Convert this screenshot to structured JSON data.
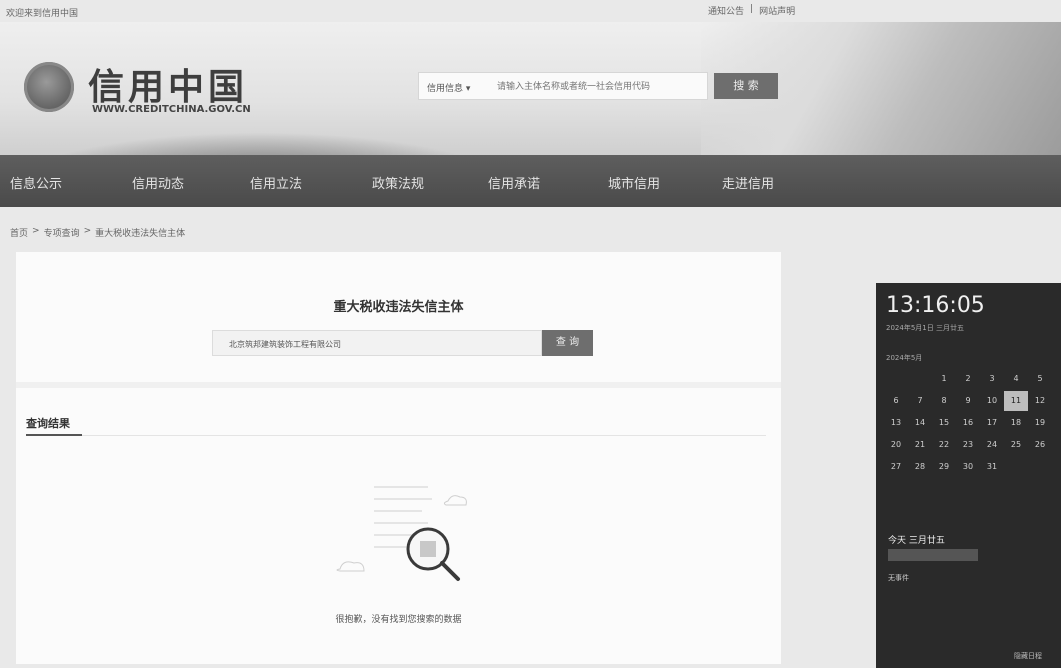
{
  "topbar": {
    "welcome": "欢迎来到信用中国",
    "notice": "通知公告",
    "separator": "|",
    "statement": "网站声明"
  },
  "header": {
    "logo_title": "信用中国",
    "logo_url": "WWW.CREDITCHINA.GOV.CN",
    "search_category": "信用信息 ▾",
    "search_placeholder": "请输入主体名称或者统一社会信用代码",
    "search_button": "搜 索"
  },
  "nav": {
    "items": [
      "信息公示",
      "信用动态",
      "信用立法",
      "政策法规",
      "信用承诺",
      "城市信用",
      "走进信用"
    ]
  },
  "breadcrumb": {
    "home": "首页",
    "sep": ">",
    "special": "专项查询",
    "current": "重大税收违法失信主体"
  },
  "main": {
    "title": "重大税收违法失信主体",
    "query_value": "北京筑邦建筑装饰工程有限公司",
    "query_button": "查 询",
    "result_heading": "查询结果",
    "empty_text": "很抱歉，没有找到您搜索的数据"
  },
  "clock": {
    "time": "13:16:05",
    "date": "2024年5月1日 三月廿五",
    "month": "2024年5月",
    "days": [
      "",
      "",
      "1",
      "2",
      "3",
      "4",
      "5",
      "6",
      "7",
      "8",
      "9",
      "10",
      "11",
      "12",
      "13",
      "14",
      "15",
      "16",
      "17",
      "18",
      "19",
      "20",
      "21",
      "22",
      "23",
      "24",
      "25",
      "26",
      "27",
      "28",
      "29",
      "30",
      "31",
      "",
      ""
    ],
    "today_label": "今天 三月廿五",
    "no_events": "无事件",
    "hide_schedule": "隐藏日程"
  }
}
